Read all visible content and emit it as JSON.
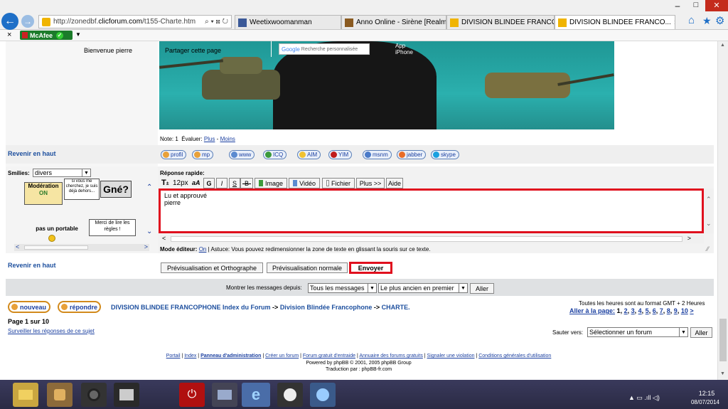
{
  "browser": {
    "address_prefix": "http://zonedbf.",
    "address_domain": "clicforum.com",
    "address_suffix": "/t155-Charte.htm",
    "address_controls": "⌕ ▾ ⊠ ↻",
    "tabs": [
      {
        "label": "Weetixwoomanman",
        "active": false
      },
      {
        "label": "Anno Online - Sirène [Realm 1]",
        "active": false
      },
      {
        "label": "DIVISION BLINDEE FRANCOPH...",
        "active": false
      },
      {
        "label": "DIVISION BLINDEE FRANCO...",
        "active": true
      }
    ],
    "tab_close": "×",
    "window_controls": {
      "minimize": "–",
      "maximize": "□",
      "close": "✕"
    },
    "toolbar_icons": {
      "home": "⌂",
      "favorites": "★",
      "settings": "⚙"
    },
    "close_bar": "×",
    "mcafee_label": "McAfee",
    "mcafee_check": "✓",
    "mcafee_dropdown": "▼"
  },
  "header": {
    "welcome": "Bienvenue pierre",
    "share_label": "Partager cette page",
    "google_placeholder": "Recherche personnalisée",
    "google_logo": "Google",
    "app_label": "App\niPhone"
  },
  "note": {
    "label": "Note:",
    "value": "1",
    "evaluer": "Évaluer:",
    "plus": "Plus",
    "separator": "-",
    "moins": "Moins"
  },
  "profile": {
    "back_to_top": "Revenir en haut",
    "buttons": [
      "profil",
      "mp",
      "www",
      "ICQ",
      "AIM",
      "YIM",
      "msnm",
      "jabber",
      "skype"
    ]
  },
  "smilies": {
    "label": "Smilies:",
    "selected": "divers",
    "moderation_line1": "Modération",
    "moderation_line2": "ON",
    "sign1": "si vous me cherchez, je suis déjà dehors...",
    "gne": "Gné?",
    "phone": "pas un portable",
    "rules": "Merci de lire les règles !"
  },
  "reply": {
    "label": "Réponse rapide:",
    "font_size": "12px",
    "toolbar": [
      "aA",
      "G",
      "I",
      "S",
      "-B-"
    ],
    "image_label": "Image",
    "video_label": "Vidéo",
    "file_label": "Fichier",
    "plus_label": "Plus >>",
    "help_label": "Aide",
    "text_line1": "Lu et approuvé",
    "text_line2": "pierre",
    "mode_label": "Mode éditeur:",
    "mode_value": "On",
    "tip": "Astuce: Vous pouvez redimensionner la zone de texte en glissant la souris sur ce texte.",
    "back_to_top": "Revenir en haut",
    "preview_spell": "Prévisualisation et Orthographe",
    "preview_normal": "Prévisualisation normale",
    "send": "Envoyer"
  },
  "filter": {
    "label": "Montrer les messages depuis:",
    "since": "Tous les messages",
    "order": "Le plus ancien en premier",
    "go": "Aller"
  },
  "nav": {
    "new_button": "nouveau",
    "reply_button": "répondre",
    "bc_index": "DIVISION BLINDEE FRANCOPHONE Index du Forum",
    "bc_arrow": "->",
    "bc_forum": "Division Blindée Francophone",
    "bc_topic": "CHARTE.",
    "timezone": "Toutes les heures sont au format GMT + 2 Heures",
    "goto_label": "Aller à la page:",
    "pages": [
      "1",
      "2",
      "3",
      "4",
      "5",
      "6",
      "7",
      "8",
      "9",
      "10"
    ],
    "next": ">",
    "page_info": "Page 1 sur 10",
    "watch": "Surveiller les réponses de ce sujet",
    "jump_label": "Sauter vers:",
    "jump_select": "Sélectionner un forum",
    "jump_go": "Aller"
  },
  "footer": {
    "links": [
      "Portail",
      "Index",
      "Panneau d'administration",
      "Créer un forum",
      "Forum gratuit d'entraide",
      "Annuaire des forums gratuits",
      "Signaler une violation",
      "Conditions générales d'utilisation"
    ],
    "powered": "Powered by phpBB © 2001, 2005 phpBB Group",
    "translation": "Traduction par : phpBB-fr.com"
  },
  "taskbar": {
    "time": "12:15",
    "date": "08/07/2014",
    "tray": "▲ ▭ .ıll ◁)"
  },
  "scrollbar": {
    "up": "▲",
    "down": "▼"
  },
  "colors": {
    "highlight_red": "#e0101e",
    "link_blue": "#1d4f9e",
    "banner_teal": "#2aa7a6"
  }
}
